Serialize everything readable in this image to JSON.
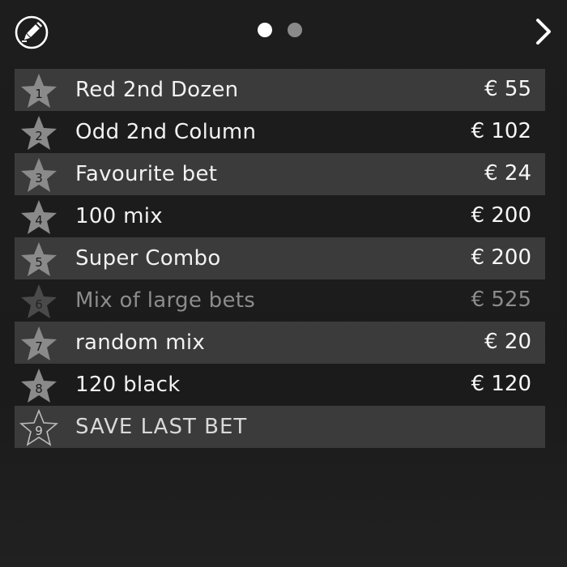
{
  "header": {
    "edit_icon": "pencil-circle-icon",
    "pages": [
      {
        "active": true
      },
      {
        "active": false
      }
    ],
    "next_icon": "chevron-right-icon"
  },
  "colors": {
    "row_highlight": "#3b3b3b",
    "star_fill": "#8a8a8a",
    "star_dim": "#4a4a4a",
    "text": "#f2f2f2",
    "text_dim": "#8c8c8c"
  },
  "bets": [
    {
      "rank": "1",
      "name": "Red 2nd Dozen",
      "amount": "€ 55"
    },
    {
      "rank": "2",
      "name": "Odd 2nd Column",
      "amount": "€ 102"
    },
    {
      "rank": "3",
      "name": "Favourite bet",
      "amount": "€ 24"
    },
    {
      "rank": "4",
      "name": "100 mix",
      "amount": "€ 200"
    },
    {
      "rank": "5",
      "name": "Super Combo",
      "amount": "€ 200"
    },
    {
      "rank": "6",
      "name": "Mix of large bets",
      "amount": "€ 525"
    },
    {
      "rank": "7",
      "name": "random mix",
      "amount": "€ 20"
    },
    {
      "rank": "8",
      "name": "120 black",
      "amount": "€ 120"
    }
  ],
  "save": {
    "rank": "9",
    "label": "SAVE LAST BET"
  }
}
